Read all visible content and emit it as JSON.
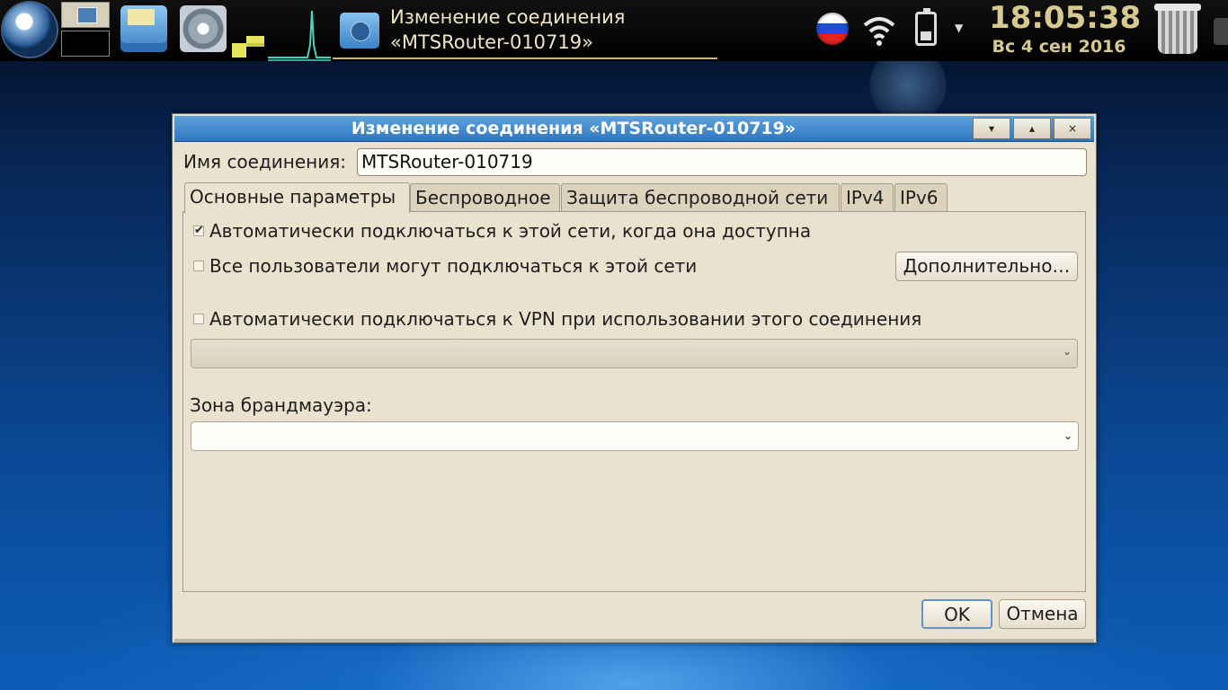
{
  "taskbar": {
    "window_title": "Изменение соединения\n«MTSRouter-010719»",
    "clock_time": "18:05:38",
    "clock_date": "Вс 4 сен 2016"
  },
  "dialog": {
    "title": "Изменение соединения «MTSRouter-010719»",
    "title_buttons": [
      "▾",
      "▴",
      "×"
    ],
    "connection_name_label": "Имя соединения:",
    "connection_name_value": "MTSRouter-010719",
    "tabs": [
      {
        "label": "Основные параметры",
        "active": true
      },
      {
        "label": "Беспроводное",
        "active": false
      },
      {
        "label": "Защита беспроводной сети",
        "active": false
      },
      {
        "label": "IPv4",
        "active": false
      },
      {
        "label": "IPv6",
        "active": false
      }
    ],
    "auto_connect": {
      "label": "Автоматически подключаться к этой сети, когда она доступна",
      "checked": true,
      "mark": "✔"
    },
    "all_users": {
      "label": "Все пользователи могут подключаться к этой сети",
      "checked": false
    },
    "advanced_button": "Дополнительно…",
    "auto_vpn": {
      "label": "Автоматически подключаться к VPN при использовании этого соединения",
      "checked": false
    },
    "vpn_select_value": "",
    "firewall_zone_label": "Зона брандмауэра:",
    "firewall_zone_value": "",
    "ok_button": "OK",
    "cancel_button": "Отмена"
  },
  "colors": {
    "titlebar": "#2f76c2",
    "dialog_bg": "#ebe1cf",
    "clock": "#d7c98f"
  }
}
